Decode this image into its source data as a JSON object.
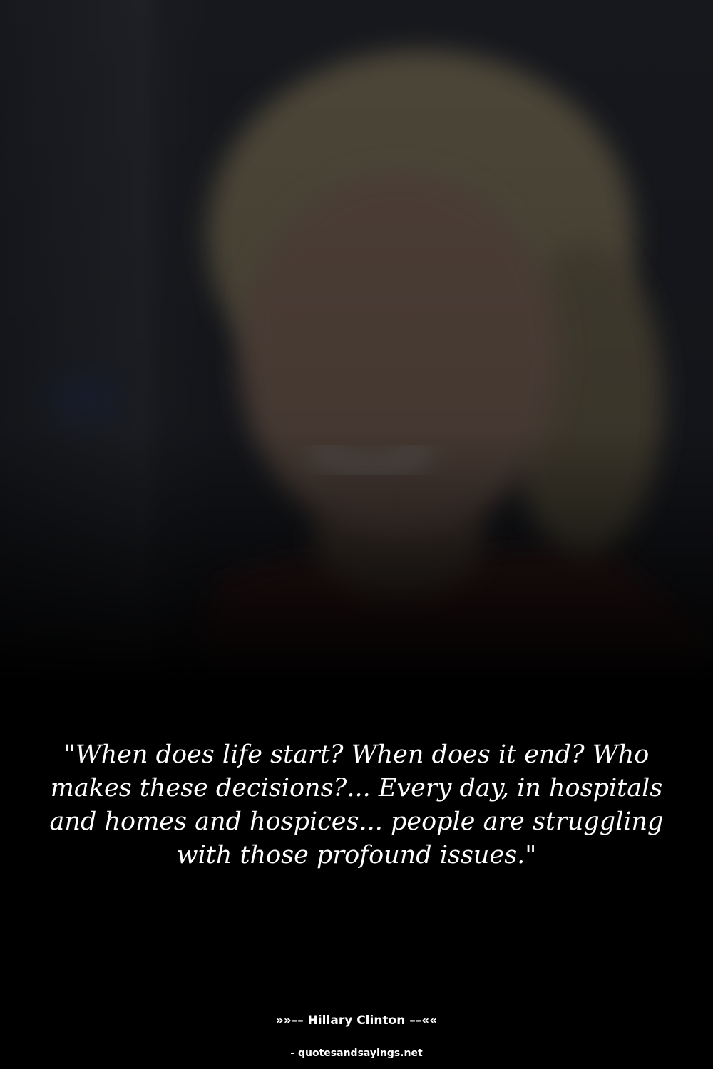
{
  "quote": {
    "text": "\"When does life start? When does it end? Who makes these decisions?... Every day, in hospitals and homes and hospices... people are struggling with those profound issues.\""
  },
  "author": {
    "line": "»»–– Hillary Clinton ––««"
  },
  "source": {
    "text": "- quotesandsayings.net"
  },
  "colors": {
    "background": "#000000",
    "text": "#ffffff"
  }
}
